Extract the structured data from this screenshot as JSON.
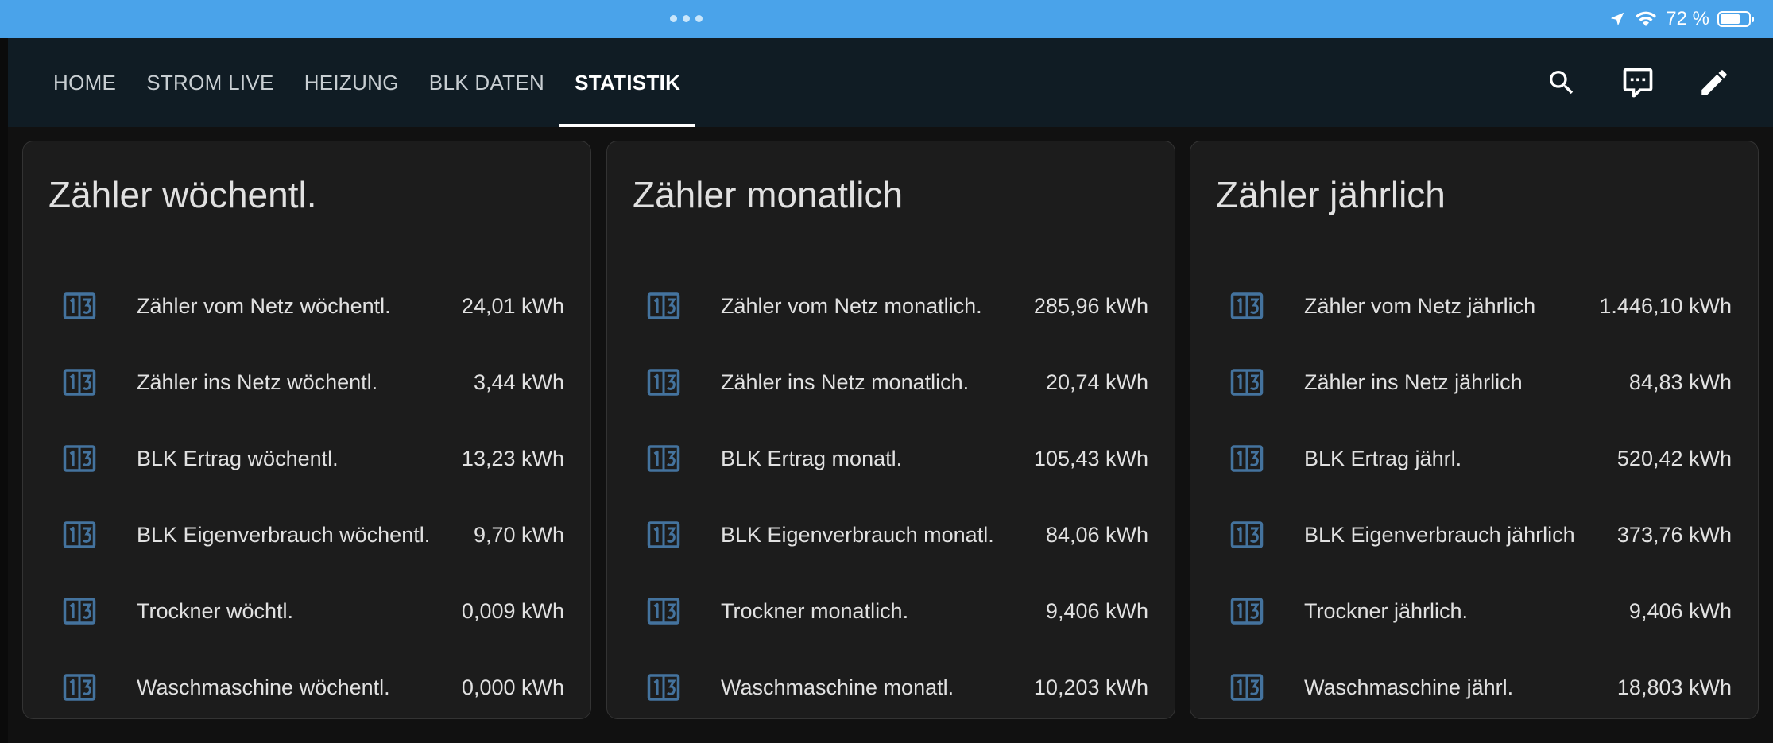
{
  "status_bar": {
    "battery_text": "72 %",
    "battery_level": 0.72,
    "icons": [
      "location-arrow-icon",
      "wifi-icon",
      "battery-icon"
    ]
  },
  "nav": {
    "tabs": [
      {
        "label": "HOME",
        "active": false
      },
      {
        "label": "STROM LIVE",
        "active": false
      },
      {
        "label": "HEIZUNG",
        "active": false
      },
      {
        "label": "BLK DATEN",
        "active": false
      },
      {
        "label": "STATISTIK",
        "active": true
      }
    ],
    "actions": [
      "search-icon",
      "assist-chat-icon",
      "edit-pencil-icon"
    ]
  },
  "colors": {
    "status_bar": "#4aa3ea",
    "header": "#101c24",
    "background": "#111111",
    "card": "#1c1c1c",
    "icon": "#44739e"
  },
  "cards": [
    {
      "title": "Zähler wöchentl.",
      "rows": [
        {
          "name": "Zähler vom Netz wöchentl.",
          "value": "24,01 kWh"
        },
        {
          "name": "Zähler ins Netz wöchentl.",
          "value": "3,44 kWh"
        },
        {
          "name": "BLK Ertrag wöchentl.",
          "value": "13,23 kWh"
        },
        {
          "name": "BLK Eigenverbrauch wöchentl.",
          "value": "9,70 kWh"
        },
        {
          "name": "Trockner wöchtl.",
          "value": "0,009 kWh"
        },
        {
          "name": "Waschmaschine wöchentl.",
          "value": "0,000 kWh"
        }
      ]
    },
    {
      "title": "Zähler monatlich",
      "rows": [
        {
          "name": "Zähler vom Netz monatlich.",
          "value": "285,96 kWh"
        },
        {
          "name": "Zähler ins Netz monatlich.",
          "value": "20,74 kWh"
        },
        {
          "name": "BLK Ertrag monatl.",
          "value": "105,43 kWh"
        },
        {
          "name": "BLK Eigenverbrauch monatl.",
          "value": "84,06 kWh"
        },
        {
          "name": "Trockner monatlich.",
          "value": "9,406 kWh"
        },
        {
          "name": "Waschmaschine monatl.",
          "value": "10,203 kWh"
        }
      ]
    },
    {
      "title": "Zähler jährlich",
      "rows": [
        {
          "name": "Zähler vom Netz jährlich",
          "value": "1.446,10 kWh"
        },
        {
          "name": "Zähler ins Netz jährlich",
          "value": "84,83 kWh"
        },
        {
          "name": "BLK Ertrag jährl.",
          "value": "520,42 kWh"
        },
        {
          "name": "BLK Eigenverbrauch jährlich",
          "value": "373,76 kWh"
        },
        {
          "name": "Trockner jährlich.",
          "value": "9,406 kWh"
        },
        {
          "name": "Waschmaschine jährl.",
          "value": "18,803 kWh"
        }
      ]
    }
  ]
}
